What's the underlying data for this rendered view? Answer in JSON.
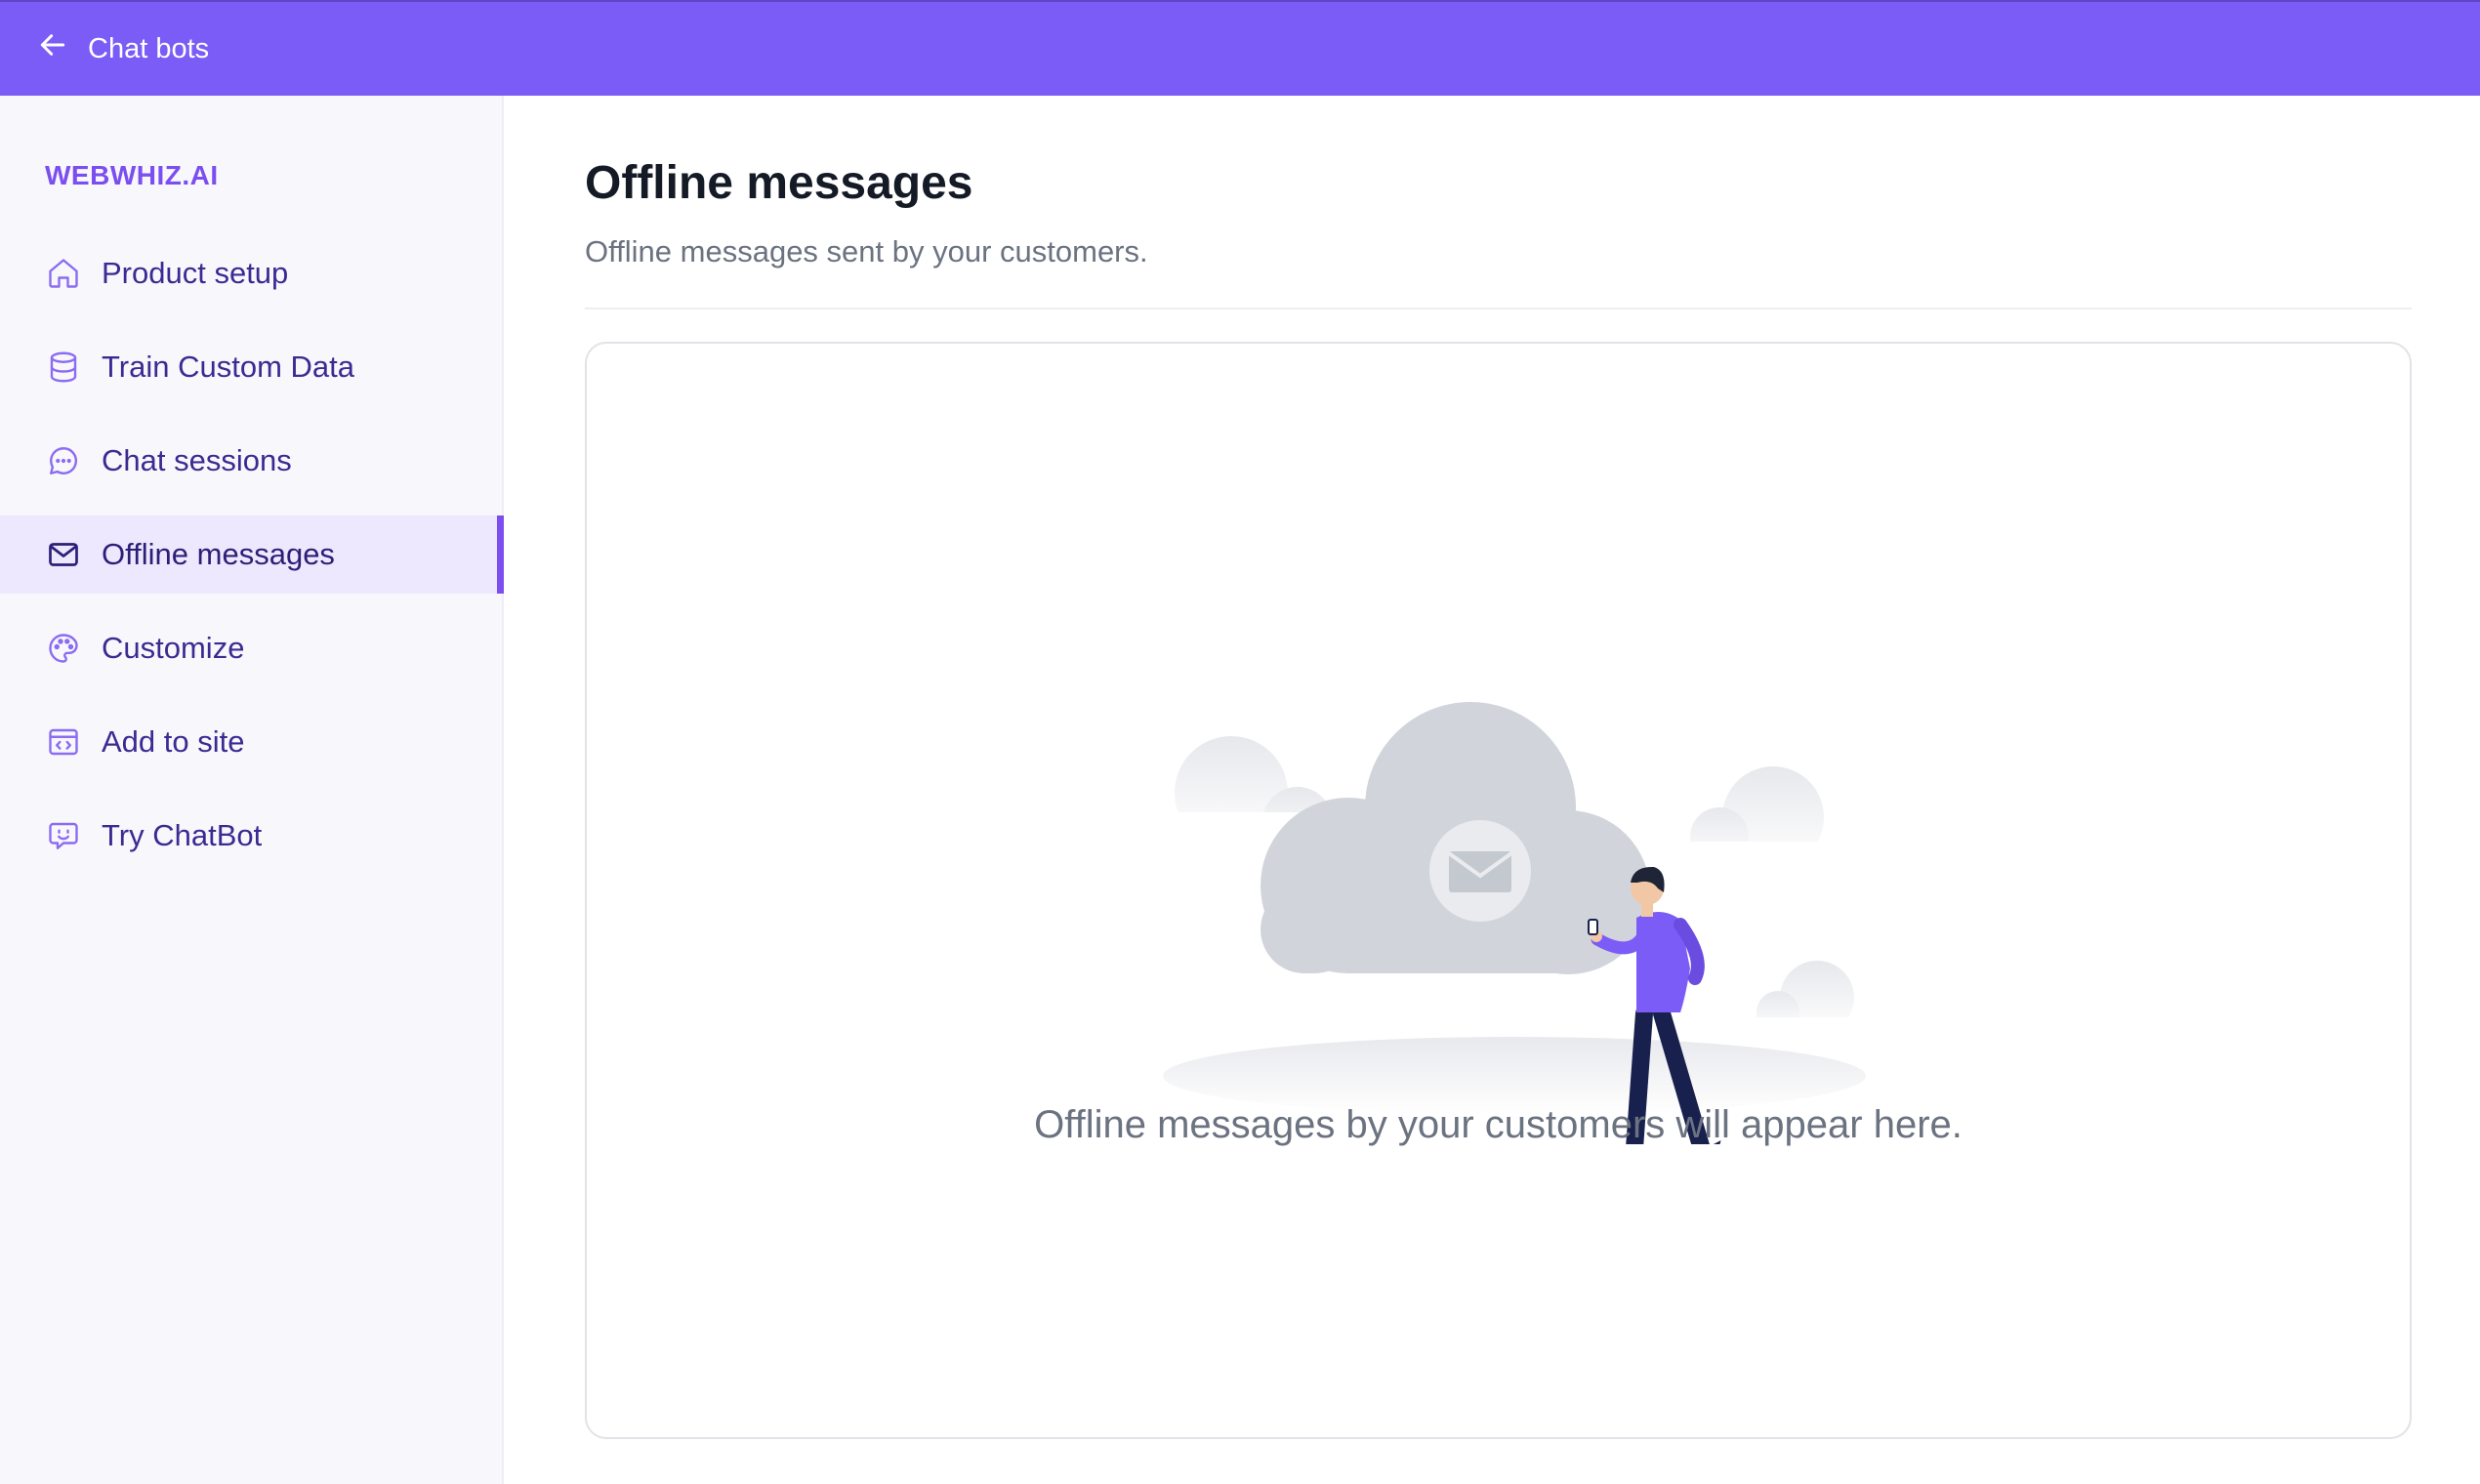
{
  "topbar": {
    "back_label": "Chat bots",
    "back_icon": "arrow-left-icon",
    "background": "#7b5cf6"
  },
  "sidebar": {
    "brand": "WEBWHIZ.AI",
    "items": [
      {
        "label": "Product setup",
        "icon": "home-icon",
        "active": false
      },
      {
        "label": "Train Custom Data",
        "icon": "database-icon",
        "active": false
      },
      {
        "label": "Chat sessions",
        "icon": "chat-bubble-icon",
        "active": false
      },
      {
        "label": "Offline messages",
        "icon": "envelope-icon",
        "active": true
      },
      {
        "label": "Customize",
        "icon": "palette-icon",
        "active": false
      },
      {
        "label": "Add to site",
        "icon": "code-window-icon",
        "active": false
      },
      {
        "label": "Try ChatBot",
        "icon": "bot-chat-icon",
        "active": false
      }
    ]
  },
  "main": {
    "title": "Offline messages",
    "subtitle": "Offline messages sent by your customers.",
    "empty_state": {
      "message": "Offline messages by your customers will appear here.",
      "illustration": "person-with-phone-and-mail-cloud"
    }
  },
  "colors": {
    "accent": "#7b4ef0",
    "active_bg": "#ede8fd",
    "nav_text": "#3c2a92"
  }
}
